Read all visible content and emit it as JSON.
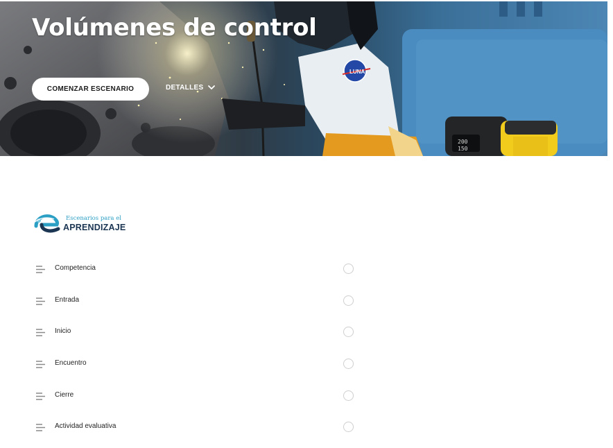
{
  "hero": {
    "title": "Volúmenes de control",
    "start_label": "COMENZAR ESCENARIO",
    "details_label": "DETALLES",
    "badge_text": "LUNA",
    "display_values": [
      "200",
      "150"
    ]
  },
  "logo": {
    "line1": "Escenarios para el",
    "line2": "APRENDIZAJE"
  },
  "sections": [
    {
      "label": "Competencia",
      "completed": false
    },
    {
      "label": "Entrada",
      "completed": false
    },
    {
      "label": "Inicio",
      "completed": false
    },
    {
      "label": "Encuentro",
      "completed": false
    },
    {
      "label": "Cierre",
      "completed": false
    },
    {
      "label": "Actividad evaluativa",
      "completed": false
    }
  ],
  "colors": {
    "logo_blue": "#2c9fc4",
    "logo_navy": "#1b3552",
    "hero_sky": "#4c86b4",
    "welder_yellow": "#f2cc1c"
  }
}
